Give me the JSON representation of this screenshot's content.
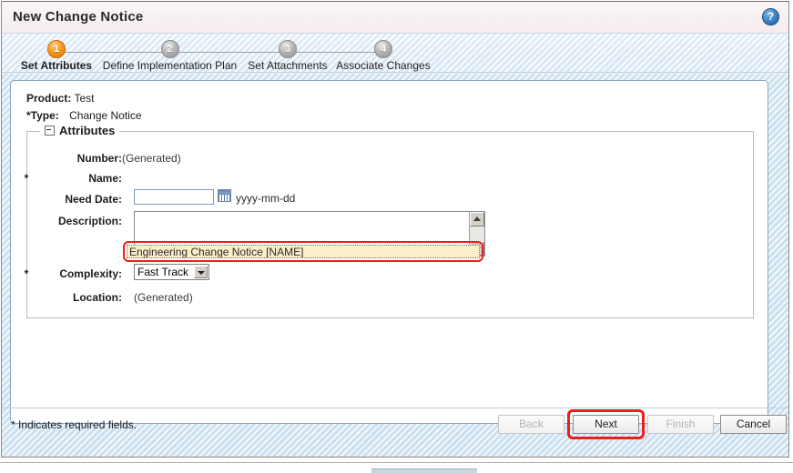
{
  "window": {
    "title": "New Change Notice",
    "help_icon": "help-icon",
    "help_glyph": "?"
  },
  "wizard": {
    "steps": [
      {
        "number": "1",
        "label": "Set Attributes",
        "active": true
      },
      {
        "number": "2",
        "label": "Define Implementation Plan",
        "active": false
      },
      {
        "number": "3",
        "label": "Set Attachments",
        "active": false
      },
      {
        "number": "4",
        "label": "Associate Changes",
        "active": false
      }
    ]
  },
  "header": {
    "product_label": "Product:",
    "product_value": "Test",
    "type_star": "*",
    "type_label": "Type:",
    "type_value": "Change Notice"
  },
  "attributes": {
    "legend": "Attributes",
    "collapse_icon": "collapse-minus-icon",
    "fields": {
      "number": {
        "label": "Number:",
        "value": "(Generated)"
      },
      "name": {
        "star": "*",
        "label": "Name:",
        "value": "Engineering Change Notice [NAME]",
        "highlighted": true
      },
      "need_date": {
        "label": "Need Date:",
        "value": "",
        "calendar_icon": "calendar-icon",
        "format_hint": "yyyy-mm-dd"
      },
      "description": {
        "label": "Description:",
        "value": "",
        "scroll_up_icon": "scroll-up-arrow-icon",
        "scroll_down_icon": "scroll-down-arrow-icon"
      },
      "complexity": {
        "star": "*",
        "label": "Complexity:",
        "value": "Fast Track",
        "dropdown_icon": "chevron-down-icon"
      },
      "location": {
        "label": "Location:",
        "value": "(Generated)"
      }
    }
  },
  "footer": {
    "required_note": "* Indicates required fields.",
    "buttons": [
      {
        "label": "Back",
        "disabled": true,
        "highlighted": false
      },
      {
        "label": "Next",
        "disabled": false,
        "highlighted": true
      },
      {
        "label": "Finish",
        "disabled": true,
        "highlighted": false
      },
      {
        "label": "Cancel",
        "disabled": false,
        "highlighted": false
      }
    ]
  },
  "colors": {
    "highlight_ring": "#ee1c1c",
    "active_step": "#f79a21",
    "inactive_step": "#b6b6b6",
    "focus_field_bg": "#faeecb",
    "panel_bg": "#ffffff"
  }
}
